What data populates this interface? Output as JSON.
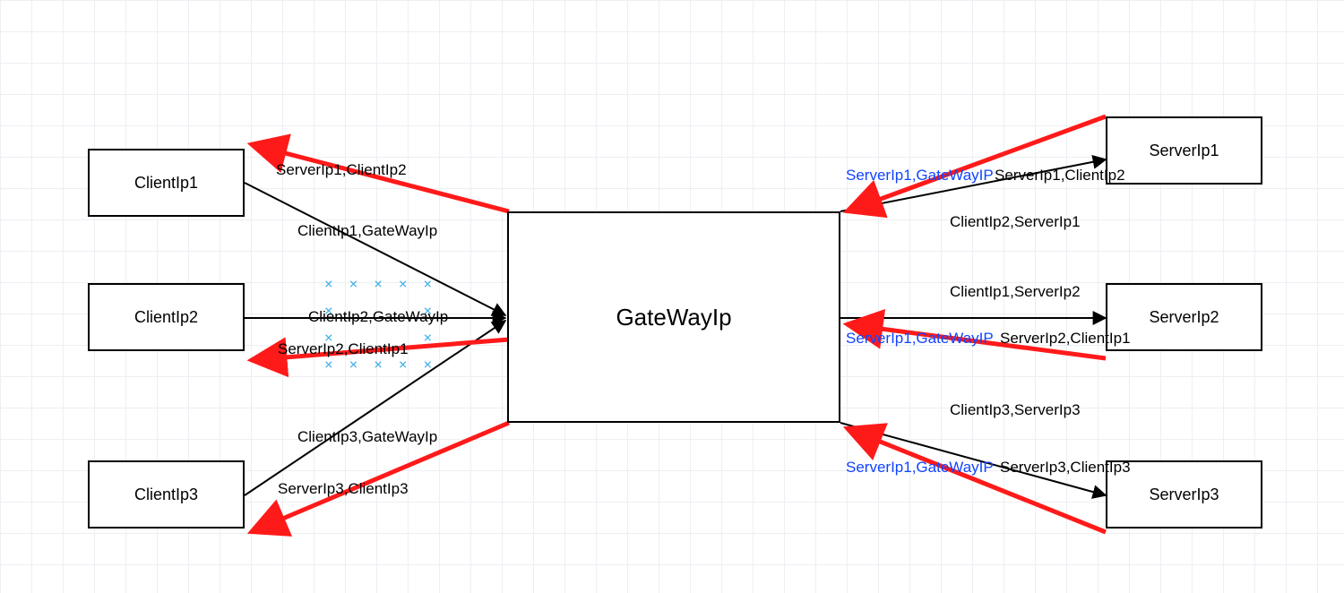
{
  "boxes": {
    "client1": "ClientIp1",
    "client2": "ClientIp2",
    "client3": "ClientIp3",
    "gateway": "GateWayIp",
    "server1": "ServerIp1",
    "server2": "ServerIp2",
    "server3": "ServerIp3"
  },
  "labels": {
    "l_s1c2_left": "ServerIp1,ClientIp2",
    "l_c1gw": "ClientIp1,GateWayIp",
    "l_c2gw": "ClientIp2,GateWayIp",
    "l_s2c1": "ServerIp2,ClientIp1",
    "l_c3gw": "ClientIp3,GateWayIp",
    "l_s3c3_left": "ServerIp3,ClientIp3",
    "l_s1gw_a": "ServerIp1,GateWayIP",
    "l_s1c2_right": "ServerIp1,ClientIp2",
    "l_c2s1": "ClientIp2,ServerIp1",
    "l_c1s2": "ClientIp1,ServerIp2",
    "l_s1gw_b": "ServerIp1,GateWayIP",
    "l_s2c1_right": "ServerIp2,ClientIp1",
    "l_c3s3": "ClientIp3,ServerIp3",
    "l_s1gw_c": "ServerIp1,GateWayIP",
    "l_s3c3_right": "ServerIp3,ClientIp3"
  },
  "colors": {
    "arrow_red": "#ff1a1a",
    "arrow_black": "#000000",
    "label_blue": "#1144ff"
  }
}
